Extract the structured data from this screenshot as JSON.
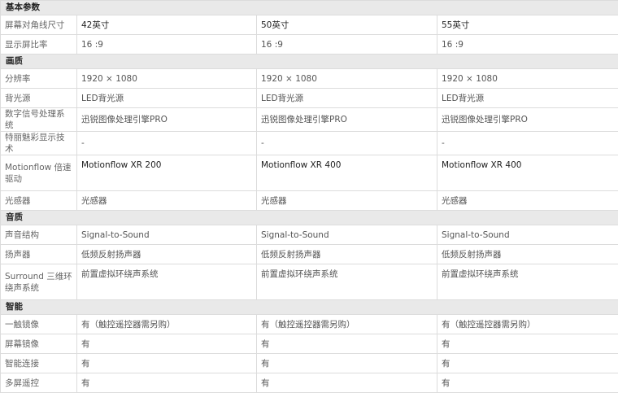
{
  "sections": [
    {
      "title": "基本参数",
      "rows": [
        {
          "label": "屏幕对角线尺寸",
          "values": [
            "42英寸",
            "50英寸",
            "55英寸"
          ],
          "dark": true
        },
        {
          "label": "显示屏比率",
          "values": [
            "16 :9",
            "16 :9",
            "16 :9"
          ]
        }
      ]
    },
    {
      "title": "画质",
      "rows": [
        {
          "label": "分辨率",
          "values": [
            "1920 × 1080",
            "1920 × 1080",
            "1920 × 1080"
          ]
        },
        {
          "label": "背光源",
          "values": [
            "LED背光源",
            "LED背光源",
            "LED背光源"
          ]
        },
        {
          "label": "数字信号处理系统",
          "values": [
            "迅锐图像处理引擎PRO",
            "迅锐图像处理引擎PRO",
            "迅锐图像处理引擎PRO"
          ]
        },
        {
          "label": "特丽魅彩显示技术",
          "values": [
            "-",
            "-",
            "-"
          ]
        },
        {
          "label": "Motionflow 倍速驱动",
          "values": [
            "Motionflow XR 200",
            "Motionflow XR 400",
            "Motionflow XR 400"
          ],
          "dark": true,
          "tall": true
        },
        {
          "label": "光感器",
          "values": [
            "光感器",
            "光感器",
            "光感器"
          ]
        }
      ]
    },
    {
      "title": "音质",
      "rows": [
        {
          "label": "声音结构",
          "values": [
            "Signal-to-Sound",
            "Signal-to-Sound",
            "Signal-to-Sound"
          ]
        },
        {
          "label": "扬声器",
          "values": [
            "低频反射扬声器",
            "低频反射扬声器",
            "低频反射扬声器"
          ]
        },
        {
          "label": "Surround 三维环绕声系统",
          "values": [
            "前置虚拟环绕声系统",
            "前置虚拟环绕声系统",
            "前置虚拟环绕声系统"
          ],
          "tall": true
        }
      ]
    },
    {
      "title": "智能",
      "rows": [
        {
          "label": "一触镜像",
          "values": [
            "有（触控遥控器需另购）",
            "有（触控遥控器需另购）",
            "有（触控遥控器需另购）"
          ]
        },
        {
          "label": "屏幕镜像",
          "values": [
            "有",
            "有",
            "有"
          ]
        },
        {
          "label": "智能连接",
          "values": [
            "有",
            "有",
            "有"
          ]
        },
        {
          "label": "多屏遥控",
          "values": [
            "有",
            "有",
            "有"
          ]
        }
      ]
    }
  ]
}
